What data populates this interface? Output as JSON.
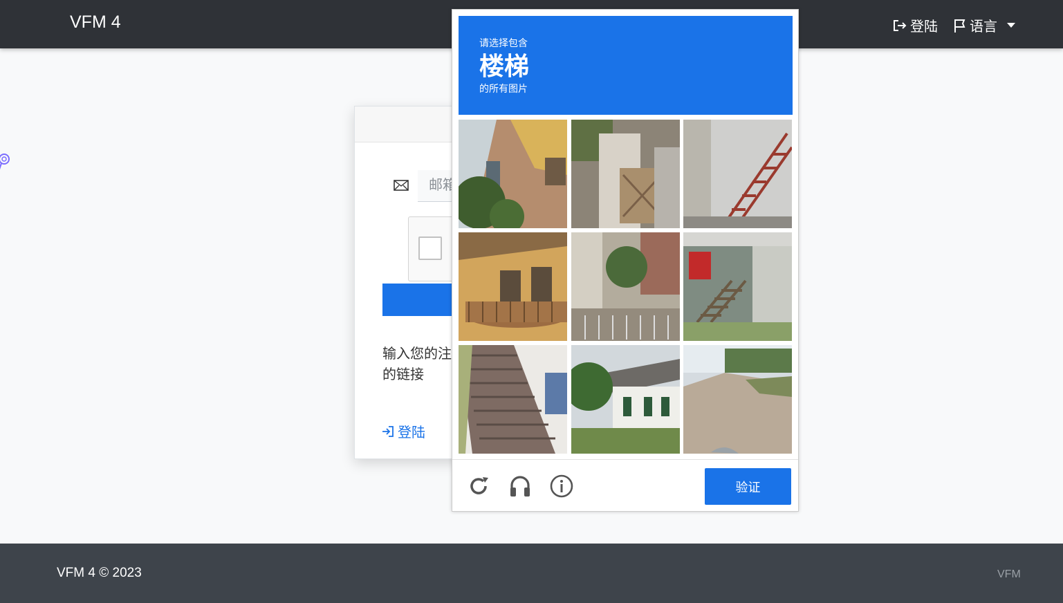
{
  "navbar": {
    "brand": "VFM 4",
    "login_label": "登陆",
    "language_label": "语言",
    "login_icon": "sign-out-icon",
    "language_icon": "flag-icon"
  },
  "card": {
    "email_placeholder": "邮箱",
    "email_icon": "envelope-icon",
    "help_text": "输入您的注 的链接",
    "login_link": "登陆",
    "login_icon": "sign-in-icon"
  },
  "captcha": {
    "instruction_line1": "请选择包含",
    "target": "楼梯",
    "instruction_line3": "的所有图片",
    "tiles": [
      {
        "scene": "building-balcony",
        "selected": false
      },
      {
        "scene": "wall-fence",
        "selected": false
      },
      {
        "scene": "red-outdoor-stairs",
        "selected": false
      },
      {
        "scene": "yellow-house-balcony",
        "selected": false
      },
      {
        "scene": "courtyard-gate",
        "selected": false
      },
      {
        "scene": "porch-stairs",
        "selected": false
      },
      {
        "scene": "staircase-closeup",
        "selected": false
      },
      {
        "scene": "white-house",
        "selected": false
      },
      {
        "scene": "road",
        "selected": false
      }
    ],
    "reload_icon": "reload-icon",
    "audio_icon": "headphones-icon",
    "info_icon": "info-icon",
    "verify_label": "验证",
    "accent": "#1a73e8"
  },
  "footer": {
    "copyright": "VFM 4 © 2023",
    "link": "VFM"
  }
}
